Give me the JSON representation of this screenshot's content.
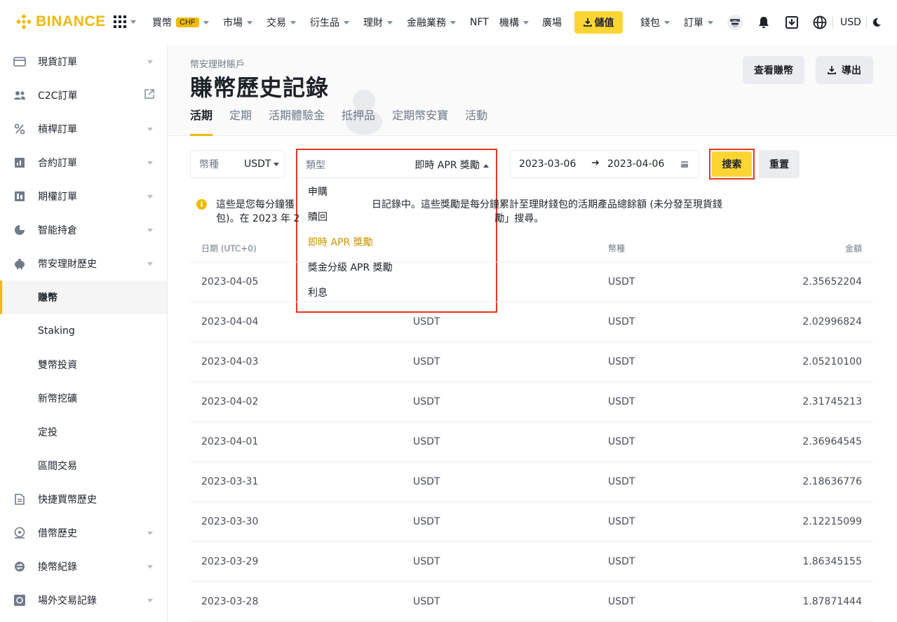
{
  "header": {
    "logo_text": "BINANCE",
    "nav": [
      {
        "label": "買幣",
        "badge": "CHF"
      },
      {
        "label": "市場"
      },
      {
        "label": "交易"
      },
      {
        "label": "衍生品"
      },
      {
        "label": "理財"
      },
      {
        "label": "金融業務"
      },
      {
        "label": "NFT"
      },
      {
        "label": "機構"
      },
      {
        "label": "廣場"
      }
    ],
    "deposit_label": "儲值",
    "wallet_label": "錢包",
    "orders_label": "訂單",
    "currency_label": "USD",
    "accent_color": "#F0B90B"
  },
  "sidebar": {
    "items": [
      {
        "label": "現貨訂單",
        "icon": "wallet-icon",
        "arrow": true
      },
      {
        "label": "C2C訂單",
        "icon": "people-icon",
        "external": true
      },
      {
        "label": "槓桿訂單",
        "icon": "percent-icon",
        "arrow": true
      },
      {
        "label": "合約訂單",
        "icon": "futures-icon",
        "arrow": true
      },
      {
        "label": "期權訂單",
        "icon": "options-icon",
        "arrow": true
      },
      {
        "label": "智能持倉",
        "icon": "pie-icon",
        "arrow": true
      },
      {
        "label": "幣安理財歷史",
        "icon": "piggy-icon",
        "arrow": true
      },
      {
        "label": "賺幣",
        "active": true
      },
      {
        "label": "Staking"
      },
      {
        "label": "雙幣投資"
      },
      {
        "label": "新幣挖礦"
      },
      {
        "label": "定投"
      },
      {
        "label": "區間交易"
      },
      {
        "label": "快捷買幣歷史",
        "icon": "document-icon"
      },
      {
        "label": "借幣歷史",
        "icon": "loan-icon",
        "arrow": true
      },
      {
        "label": "換幣紀錄",
        "icon": "convert-icon",
        "arrow": true
      },
      {
        "label": "場外交易記錄",
        "icon": "otc-icon",
        "arrow": true
      }
    ]
  },
  "page": {
    "breadcrumb": "幣安理財賬戶",
    "title": "賺幣歷史記錄",
    "view_button": "查看賺幣",
    "export_button": "導出",
    "tabs": [
      "活期",
      "定期",
      "活期體驗金",
      "抵押品",
      "定期幣安寶",
      "活動"
    ]
  },
  "filters": {
    "coin_label": "幣種",
    "coin_value": "USDT",
    "type_label": "類型",
    "type_value": "即時 APR 獎勵",
    "type_options": [
      "申購",
      "贖回",
      "即時 APR 獎勵",
      "獎金分級 APR 獎勵",
      "利息"
    ],
    "type_selected_index": 2,
    "date_from": "2023-03-06",
    "date_to": "2023-04-06",
    "search_label": "搜索",
    "reset_label": "重置"
  },
  "notice": {
    "line1_a": "這些是您每分鐘獲",
    "line1_b": "日記錄中。這些獎勵是每分鐘累計至理財錢包的活期產品總餘額 (未分發至現貨錢",
    "line2_a": "包)。在 2023 年 2",
    "line2_b": "勵」搜尋。"
  },
  "table": {
    "headers": [
      "日期 (UTC+0)",
      "",
      "幣種",
      "金額"
    ],
    "rows": [
      {
        "date": "2023-04-05",
        "coin_a": "",
        "coin": "USDT",
        "amount": "2.35652204"
      },
      {
        "date": "2023-04-04",
        "coin_a": "USDT",
        "coin": "USDT",
        "amount": "2.02996824"
      },
      {
        "date": "2023-04-03",
        "coin_a": "USDT",
        "coin": "USDT",
        "amount": "2.05210100"
      },
      {
        "date": "2023-04-02",
        "coin_a": "USDT",
        "coin": "USDT",
        "amount": "2.31745213"
      },
      {
        "date": "2023-04-01",
        "coin_a": "USDT",
        "coin": "USDT",
        "amount": "2.36964545"
      },
      {
        "date": "2023-03-31",
        "coin_a": "USDT",
        "coin": "USDT",
        "amount": "2.18636776"
      },
      {
        "date": "2023-03-30",
        "coin_a": "USDT",
        "coin": "USDT",
        "amount": "2.12215099"
      },
      {
        "date": "2023-03-29",
        "coin_a": "USDT",
        "coin": "USDT",
        "amount": "1.86345155"
      },
      {
        "date": "2023-03-28",
        "coin_a": "USDT",
        "coin": "USDT",
        "amount": "1.87871444"
      }
    ]
  }
}
